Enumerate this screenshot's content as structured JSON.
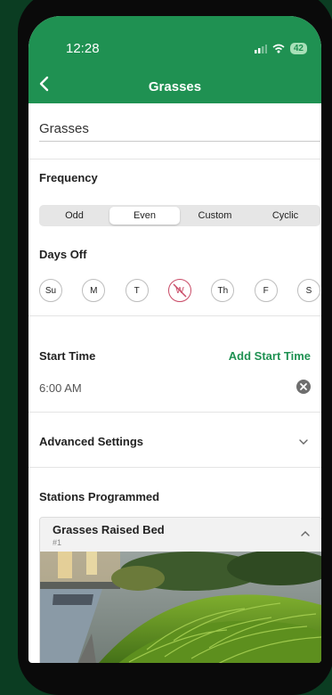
{
  "status_bar": {
    "time": "12:28",
    "battery": "42"
  },
  "header": {
    "title": "Grasses"
  },
  "program": {
    "name_value": "Grasses"
  },
  "frequency": {
    "label": "Frequency",
    "options": [
      "Odd",
      "Even",
      "Custom",
      "Cyclic"
    ],
    "selected": "Even"
  },
  "days_off": {
    "label": "Days Off",
    "days": [
      "Su",
      "M",
      "T",
      "W",
      "Th",
      "F",
      "S"
    ],
    "off_days": [
      "W"
    ]
  },
  "start_time": {
    "label": "Start Time",
    "add_label": "Add Start Time",
    "times": [
      "6:00 AM"
    ]
  },
  "advanced": {
    "label": "Advanced Settings"
  },
  "stations": {
    "label": "Stations Programmed",
    "items": [
      {
        "name": "Grasses Raised Bed",
        "number": "#1"
      }
    ]
  },
  "colors": {
    "brand_green": "#1f9152",
    "off_day": "#c94a66",
    "background": "#0b3d22"
  },
  "icons": [
    "chevron-left-icon",
    "signal-icon",
    "wifi-icon",
    "battery-icon",
    "clear-icon",
    "chevron-down-icon",
    "chevron-up-icon"
  ]
}
